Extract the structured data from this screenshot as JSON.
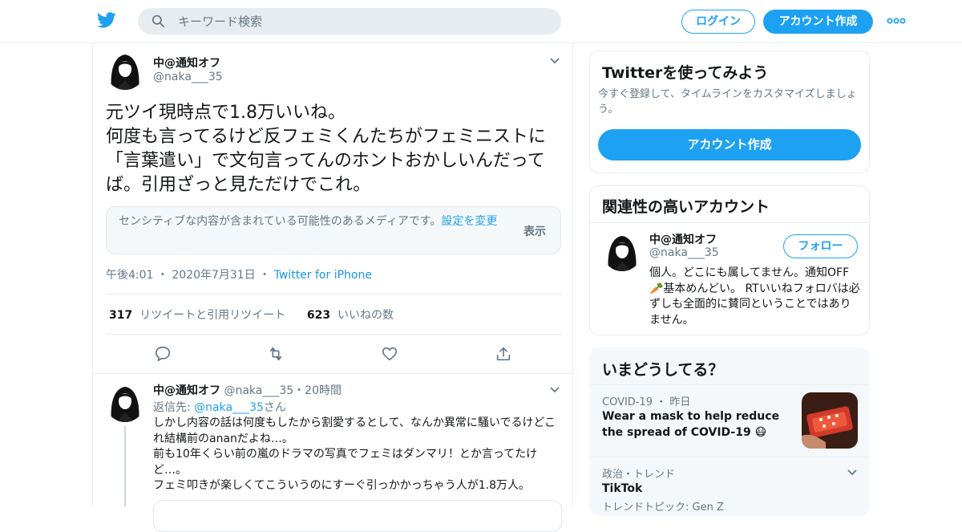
{
  "header": {
    "search_placeholder": "キーワード検索",
    "login_label": "ログイン",
    "signup_label": "アカウント作成",
    "accent_color": "#1da1f2"
  },
  "tweet": {
    "author_name": "中@通知オフ",
    "author_handle": "@naka___35",
    "text": "元ツイ現時点で1.8万いいね。\n何度も言ってるけど反フェミくんたちがフェミニストに「言葉遣い」で文句言ってんのホントおかしいんだってば。引用ざっと見ただけでこれ。",
    "sensitive_notice": "センシティブな内容が含まれている可能性のあるメディアです。",
    "sensitive_link": "設定を変更",
    "sensitive_show": "表示",
    "time": "午後4:01",
    "date": "2020年7月31日",
    "source": "Twitter for iPhone",
    "retweet_count": "317",
    "retweet_label": "リツイートと引用リツイート",
    "like_count": "623",
    "like_label": "いいねの数"
  },
  "reply": {
    "author_name": "中@通知オフ",
    "author_handle": "@naka___35",
    "age": "20時間",
    "reply_prefix": "返信先: ",
    "reply_handle": "@naka___35",
    "reply_suffix": "さん",
    "text": "しかし内容の話は何度もしたから割愛するとして、なんか異常に騒いでるけどこれ結構前のananだよね…。\n前も10年くらい前の嵐のドラマの写真でフェミはダンマリ！とか言ってたけど…。\nフェミ叩きが楽しくてこういうのにすーぐ引っかかっちゃう人が1.8万人。"
  },
  "signup_card": {
    "title": "Twitterを使ってみよう",
    "subtitle": "今すぐ登録して、タイムラインをカスタマイズしましょう。",
    "cta": "アカウント作成"
  },
  "related": {
    "title": "関連性の高いアカウント",
    "name": "中@通知オフ",
    "handle": "@naka___35",
    "follow_label": "フォロー",
    "bio": "個人。どこにも属してません。通知OFF🥕基本めんどい。 RTいいねフォロバは必ずしも全面的に賛同ということではありません。"
  },
  "trends": {
    "title": "いまどうしてる？",
    "items": [
      {
        "category": "COVID-19",
        "time": "昨日",
        "title": "Wear a mask to help reduce the spread of COVID-19 😷"
      },
      {
        "category": "政治・トレンド",
        "title": "TikTok",
        "sub": "トレンドトピック: Gen Z"
      }
    ]
  }
}
